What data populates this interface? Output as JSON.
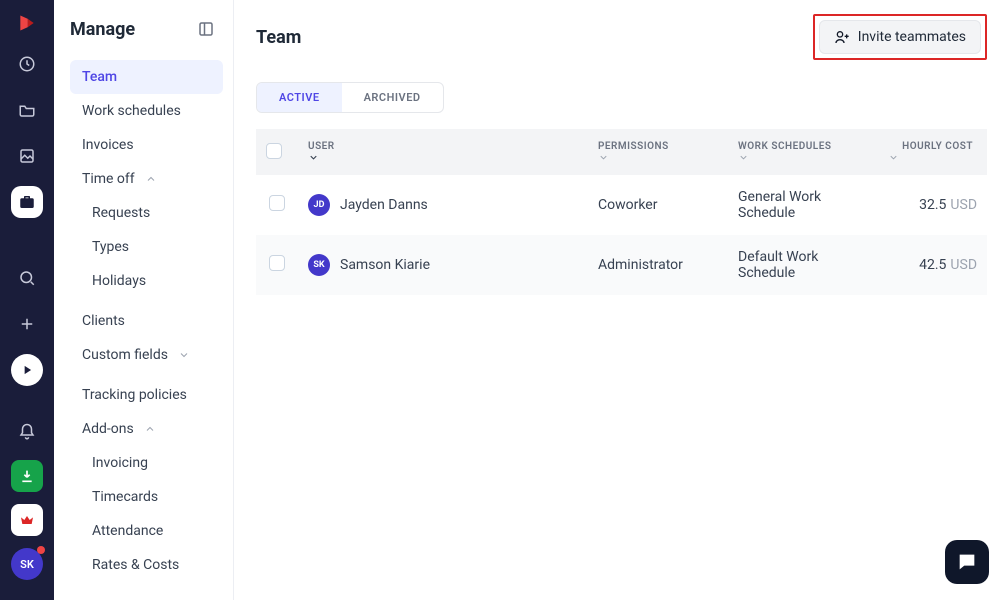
{
  "rail": {
    "avatar_initials": "SK"
  },
  "sidebar": {
    "title": "Manage",
    "items": {
      "team": "Team",
      "work_schedules": "Work schedules",
      "invoices": "Invoices",
      "time_off": "Time off",
      "requests": "Requests",
      "types": "Types",
      "holidays": "Holidays",
      "clients": "Clients",
      "custom_fields": "Custom fields",
      "tracking_policies": "Tracking policies",
      "addons": "Add-ons",
      "invoicing": "Invoicing",
      "timecards": "Timecards",
      "attendance": "Attendance",
      "rates_costs": "Rates & Costs"
    }
  },
  "main": {
    "title": "Team",
    "invite_label": "Invite teammates",
    "tabs": {
      "active": "ACTIVE",
      "archived": "ARCHIVED"
    },
    "columns": {
      "user": "USER",
      "permissions": "PERMISSIONS",
      "work_schedules": "WORK SCHEDULES",
      "hourly_cost": "HOURLY COST"
    },
    "currency": "USD",
    "rows": [
      {
        "initials": "JD",
        "name": "Jayden Danns",
        "permission": "Coworker",
        "schedule": "General Work Schedule",
        "cost": "32.5"
      },
      {
        "initials": "SK",
        "name": "Samson Kiarie",
        "permission": "Administrator",
        "schedule": "Default Work Schedule",
        "cost": "42.5"
      }
    ]
  }
}
